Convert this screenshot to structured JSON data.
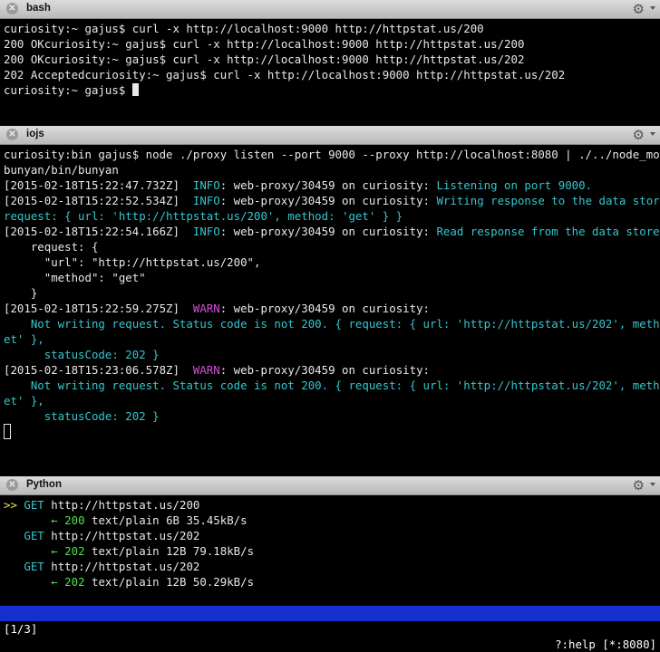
{
  "bash": {
    "title": "bash",
    "lines": [
      "curiosity:~ gajus$ curl -x http://localhost:9000 http://httpstat.us/200",
      "200 OKcuriosity:~ gajus$ curl -x http://localhost:9000 http://httpstat.us/200",
      "200 OKcuriosity:~ gajus$ curl -x http://localhost:9000 http://httpstat.us/202",
      "202 Acceptedcuriosity:~ gajus$ curl -x http://localhost:9000 http://httpstat.us/202",
      "curiosity:~ gajus$ "
    ]
  },
  "iojs": {
    "title": "iojs",
    "cmd1": "curiosity:bin gajus$ node ./proxy listen --port 9000 --proxy http://localhost:8080 | ./../node_modules/",
    "cmd2": "bunyan/bin/bunyan",
    "l1_ts": "[2015-02-18T15:22:47.732Z]",
    "l1_lvl": "INFO",
    "l1_src": ": web-proxy/30459 on curiosity: ",
    "l1_msg": "Listening on port 9000.",
    "l2_ts": "[2015-02-18T15:22:52.534Z]",
    "l2_lvl": "INFO",
    "l2_src": ": web-proxy/30459 on curiosity: ",
    "l2_msg": "Writing response to the data store. { r",
    "l2_cont": "request: { url: 'http://httpstat.us/200', method: 'get' } }",
    "l3_ts": "[2015-02-18T15:22:54.166Z]",
    "l3_lvl": "INFO",
    "l3_src": ": web-proxy/30459 on curiosity: ",
    "l3_msg": "Read response from the data store.",
    "obj1": "    request: {",
    "obj2": "      \"url\": \"http://httpstat.us/200\",",
    "obj3": "      \"method\": \"get\"",
    "obj4": "    }",
    "w1_ts": "[2015-02-18T15:22:59.275Z]",
    "w1_lvl": "WARN",
    "w1_src": ": web-proxy/30459 on curiosity:",
    "w1_m1": "    Not writing request. Status code is not 200. { request: { url: 'http://httpstat.us/202', method: 'g",
    "w1_m2": "et' },",
    "w1_m3": "      statusCode: 202 }",
    "w2_ts": "[2015-02-18T15:23:06.578Z]",
    "w2_lvl": "WARN",
    "w2_src": ": web-proxy/30459 on curiosity:",
    "w2_m1": "    Not writing request. Status code is not 200. { request: { url: 'http://httpstat.us/202', method: 'g",
    "w2_m2": "et' },",
    "w2_m3": "      statusCode: 202 }"
  },
  "python": {
    "title": "Python",
    "marker": ">>",
    "entries": [
      {
        "method": "GET",
        "url": "http://httpstat.us/200",
        "arrow": "←",
        "code": "200",
        "info": "text/plain 6B 35.45kB/s"
      },
      {
        "method": "GET",
        "url": "http://httpstat.us/202",
        "arrow": "←",
        "code": "202",
        "info": "text/plain 12B 79.18kB/s"
      },
      {
        "method": "GET",
        "url": "http://httpstat.us/202",
        "arrow": "←",
        "code": "202",
        "info": "text/plain 12B 50.29kB/s"
      }
    ]
  },
  "statusbar": {
    "left": "[1/3]",
    "right": "?:help [*:8080]"
  },
  "icons": {
    "close": "close-icon",
    "gear": "gear-icon",
    "caret": "chevron-down-icon"
  },
  "colors": {
    "titlebar": "#c8c8c8",
    "cyan": "#34c6cf",
    "magenta": "#d050d0",
    "green": "#4fe050",
    "yellow": "#e8e84a",
    "statusbar": "#1630d0"
  }
}
